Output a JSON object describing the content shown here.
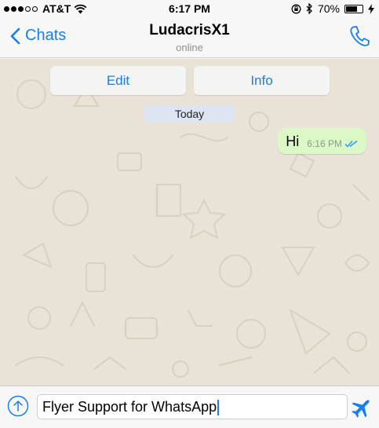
{
  "status_bar": {
    "carrier": "AT&T",
    "time": "6:17 PM",
    "battery": "70%",
    "battery_level": 0.7
  },
  "nav": {
    "back_label": "Chats",
    "title": "LudacrisX1",
    "subtitle": "online"
  },
  "actions": {
    "edit_label": "Edit",
    "info_label": "Info"
  },
  "chat": {
    "day_label": "Today",
    "messages": [
      {
        "text": "Hi",
        "time": "6:16 PM",
        "status": "read",
        "direction": "outgoing"
      }
    ]
  },
  "composer": {
    "value": "Flyer Support for WhatsApp"
  },
  "colors": {
    "accent": "#1a7ee6",
    "outgoing_bubble": "#dcf8c6",
    "wallpaper": "#e9e2d6"
  }
}
